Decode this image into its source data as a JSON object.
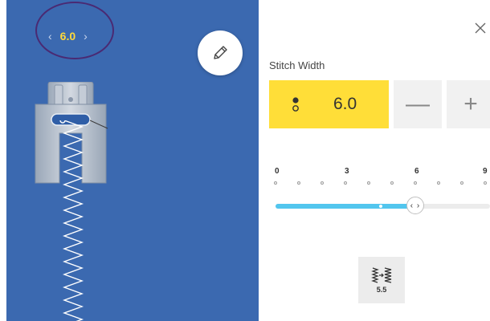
{
  "preview": {
    "width_value": "6.0",
    "prev_glyph": "‹",
    "next_glyph": "›"
  },
  "panel": {
    "title": "Stitch Width",
    "value": "6.0",
    "minus_label": "—",
    "plus_label": "+",
    "close_glyph": "×",
    "scale": {
      "labels": [
        "0",
        "3",
        "6",
        "9"
      ],
      "min": 0,
      "max": 9,
      "current": 6.0,
      "default_marker": 4.5
    },
    "thumb_glyph": "‹ ›",
    "stitch_preset": {
      "value": "5.5"
    }
  },
  "colors": {
    "preview_bg": "#3b69b0",
    "accent_yellow": "#ffde38",
    "slider_fill": "#52c6ee",
    "highlight_circle": "#4a2a73"
  },
  "icons": [
    "pencil-icon",
    "close-icon",
    "needle-position-icon",
    "zigzag-width-icon",
    "presser-foot",
    "zigzag-stitch"
  ]
}
